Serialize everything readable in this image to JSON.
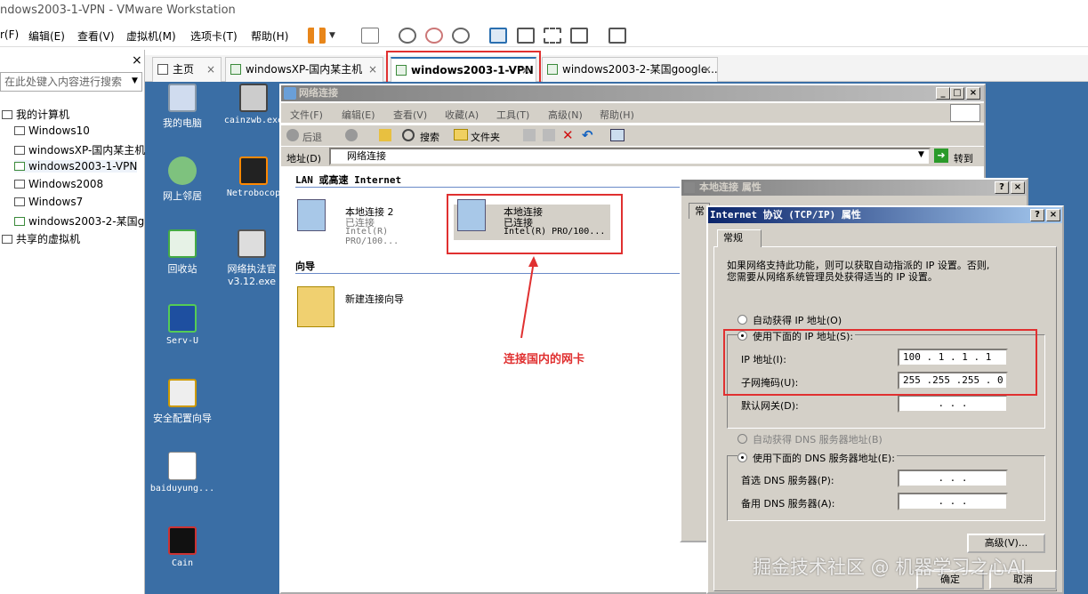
{
  "app": {
    "title": "ndows2003-1-VPN - VMware Workstation"
  },
  "menu": [
    "r(F)",
    "编辑(E)",
    "查看(V)",
    "虚拟机(M)",
    "选项卡(T)",
    "帮助(H)"
  ],
  "library": {
    "search_placeholder": "在此处键入内容进行搜索",
    "close": "×",
    "root": "我的计算机",
    "items": [
      "Windows10",
      "windowsXP-国内某主机",
      "windows2003-1-VPN",
      "Windows2008",
      "Windows7",
      "windows2003-2-某国g"
    ],
    "shared": "共享的虚拟机"
  },
  "tabs": [
    {
      "label": "主页",
      "close": "×"
    },
    {
      "label": "windowsXP-国内某主机",
      "close": "×"
    },
    {
      "label": "windows2003-1-VPN",
      "close": "×"
    },
    {
      "label": "windows2003-2-某国google...",
      "close": "×"
    }
  ],
  "desktop_icons": [
    "我的电脑",
    "cainzwb.exe",
    "网上邻居",
    "Netrobocop",
    "回收站",
    "网络执法官\nv3.12.exe",
    "Serv-U",
    "安全配置向导",
    "baiduyung...",
    "Cain"
  ],
  "netconn": {
    "title": "网络连接",
    "menu": [
      "文件(F)",
      "编辑(E)",
      "查看(V)",
      "收藏(A)",
      "工具(T)",
      "高级(N)",
      "帮助(H)"
    ],
    "toolbar": {
      "back": "后退",
      "search": "搜索",
      "folders": "文件夹"
    },
    "address_label": "地址(D)",
    "address_value": "网络连接",
    "go": "转到",
    "section_lan": "LAN 或高速 Internet",
    "conn2": {
      "name": "本地连接 2",
      "status": "已连接",
      "device": "Intel(R) PRO/100..."
    },
    "conn1": {
      "name": "本地连接",
      "status": "已连接",
      "device": "Intel(R) PRO/100..."
    },
    "section_wizard": "向导",
    "wizard": "新建连接向导"
  },
  "annotation": "连接国内的网卡",
  "props": {
    "title": "本地连接 属性",
    "tab": "常"
  },
  "tcpip": {
    "title": "Internet 协议 (TCP/IP) 属性",
    "tab": "常规",
    "desc1": "如果网络支持此功能，则可以获取自动指派的 IP 设置。否则,",
    "desc2": "您需要从网络系统管理员处获得适当的 IP 设置。",
    "auto_ip": "自动获得 IP 地址(O)",
    "manual_ip": "使用下面的 IP 地址(S):",
    "ip_label": "IP 地址(I):",
    "ip_value": "100 . 1 . 1 . 1",
    "mask_label": "子网掩码(U):",
    "mask_value": "255 .255 .255 . 0",
    "gw_label": "默认网关(D):",
    "gw_value": ".    .    .",
    "auto_dns": "自动获得 DNS 服务器地址(B)",
    "manual_dns": "使用下面的 DNS 服务器地址(E):",
    "dns1_label": "首选 DNS 服务器(P):",
    "dns1_value": ".    .    .",
    "dns2_label": "备用 DNS 服务器(A):",
    "dns2_value": ".    .    .",
    "advanced": "高级(V)...",
    "ok": "确定",
    "cancel": "取消"
  },
  "watermark": "掘金技术社区 @ 机器学习之心AI"
}
